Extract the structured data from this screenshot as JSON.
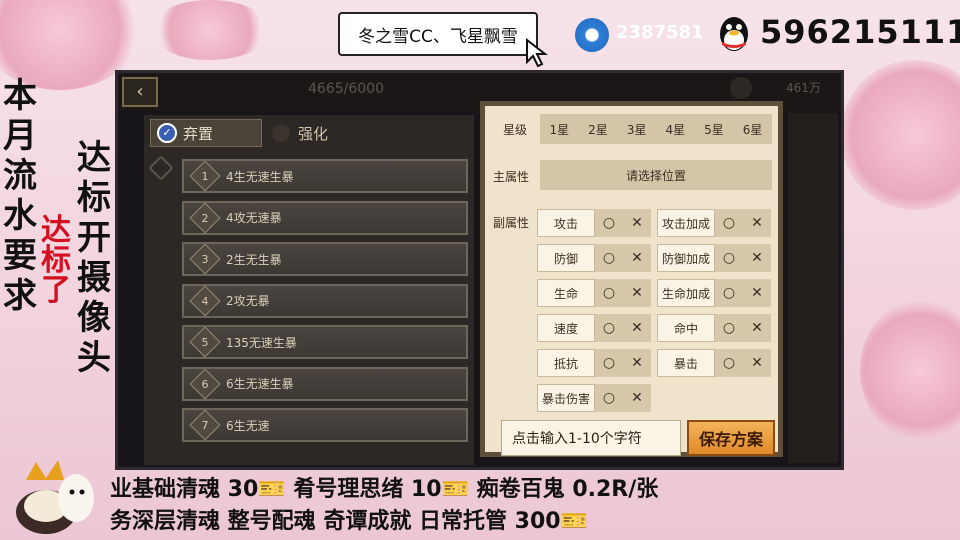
{
  "overlay": {
    "title_card": "冬之雪CC、飞星飘雪",
    "social_id": "2387581",
    "qq_number": "596215111",
    "left_vertical_col1": [
      "本",
      "月",
      "流",
      "水",
      "要",
      "求"
    ],
    "left_vertical_red": [
      "达",
      "标",
      "了"
    ],
    "left_vertical_col2": [
      "达",
      "标",
      "开",
      "摄",
      "像",
      "头"
    ],
    "bottom_line1": "业基础清魂 30🎫 肴号理思绪 10🎫 痴卷百鬼 0.2R/张",
    "bottom_line2": "务深层清魂 整号配魂 奇谭成就 日常托管 300🎫"
  },
  "game": {
    "back_icon": "back-arrow-icon",
    "souls_count": "4665/6000",
    "money": "461万",
    "tabs": [
      {
        "label": "弃置",
        "active": true
      },
      {
        "label": "强化",
        "active": false
      }
    ],
    "plans": [
      {
        "num": "1",
        "label": "4生无速生暴"
      },
      {
        "num": "2",
        "label": "4攻无速暴"
      },
      {
        "num": "3",
        "label": "2生无生暴"
      },
      {
        "num": "4",
        "label": "2攻无暴"
      },
      {
        "num": "5",
        "label": "135无速生暴"
      },
      {
        "num": "6",
        "label": "6生无速生暴"
      },
      {
        "num": "7",
        "label": "6生无速"
      }
    ],
    "dialog": {
      "star_label": "星级",
      "stars": [
        "1星",
        "2星",
        "3星",
        "4星",
        "5星",
        "6星"
      ],
      "main_attr_label": "主属性",
      "main_attr_placeholder": "请选择位置",
      "sub_attr_label": "副属性",
      "sub_attrs_left": [
        "攻击",
        "防御",
        "生命",
        "速度",
        "抵抗",
        "暴击伤害"
      ],
      "sub_attrs_right": [
        "攻击加成",
        "防御加成",
        "生命加成",
        "命中",
        "暴击"
      ],
      "opt_yes": "○",
      "opt_no": "✕",
      "input_placeholder": "点击输入1-10个字符",
      "save_label": "保存方案"
    }
  },
  "colors": {
    "dialog_bg": "#f0e3cb",
    "save_button": "#e08a2a",
    "dark_frame": "#17141a",
    "overlay_pink": "#f2d3de",
    "red_text": "#d40f22"
  }
}
